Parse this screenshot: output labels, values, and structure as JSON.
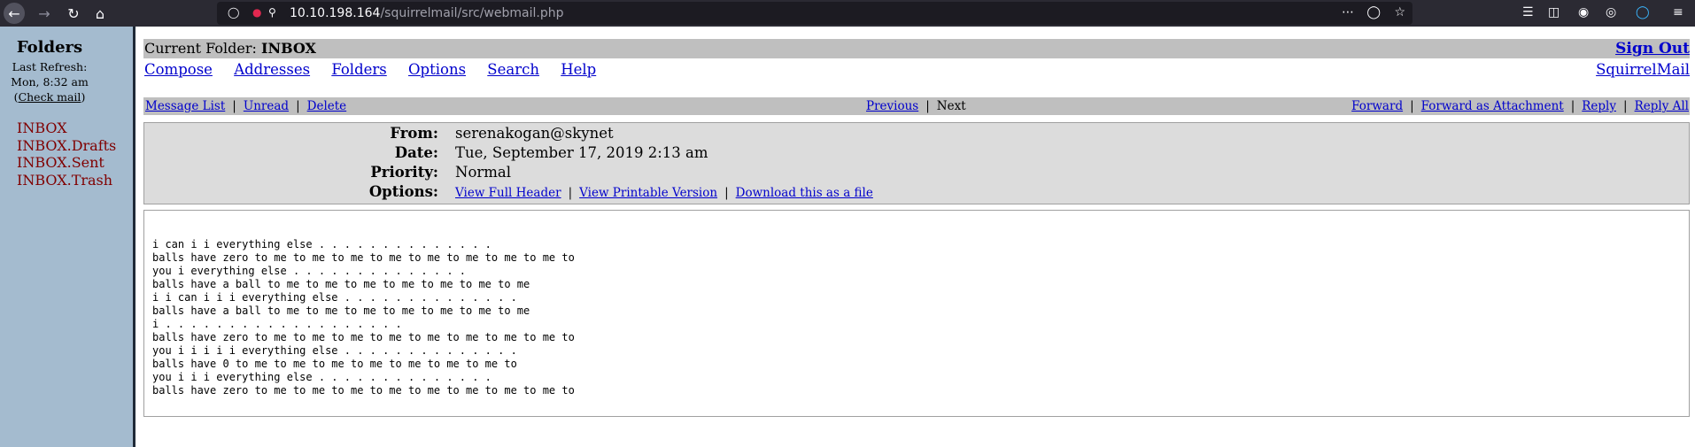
{
  "browser": {
    "url_host": "10.10.198.164",
    "url_path": "/squirrelmail/src/webmail.php"
  },
  "left": {
    "title": "Folders",
    "last_refresh_label": "Last  Refresh:",
    "last_refresh_time": "Mon,  8:32  am",
    "check_mail": "Check mail",
    "folders": [
      "INBOX",
      "INBOX.Drafts",
      "INBOX.Sent",
      "INBOX.Trash"
    ]
  },
  "header": {
    "current_folder_label": "Current Folder: ",
    "current_folder": "INBOX",
    "sign_out": "Sign Out",
    "menu": [
      "Compose",
      "Addresses",
      "Folders",
      "Options",
      "Search",
      "Help"
    ],
    "squirrelmail": "SquirrelMail"
  },
  "nav": {
    "message_list": "Message List",
    "unread": "Unread",
    "delete": "Delete",
    "previous": "Previous",
    "next": "Next",
    "forward": "Forward",
    "forward_attachment": "Forward as Attachment",
    "reply": "Reply",
    "reply_all": "Reply All"
  },
  "message": {
    "from_label": "From:",
    "from": "serenakogan@skynet",
    "date_label": "Date:",
    "date": "Tue, September 17, 2019 2:13 am",
    "priority_label": "Priority:",
    "priority": "Normal",
    "options_label": "Options:",
    "view_full_header": "View Full Header",
    "view_printable": "View Printable Version",
    "download": "Download this as a file",
    "body": "i can i i everything else . . . . . . . . . . . . . .\nballs have zero to me to me to me to me to me to me to me to me to\nyou i everything else . . . . . . . . . . . . . .\nballs have a ball to me to me to me to me to me to me to me\ni i can i i i everything else . . . . . . . . . . . . . .\nballs have a ball to me to me to me to me to me to me to me\ni . . . . . . . . . . . . . . . . . . .\nballs have zero to me to me to me to me to me to me to me to me to\nyou i i i i i everything else . . . . . . . . . . . . . .\nballs have 0 to me to me to me to me to me to me to me to\nyou i i i everything else . . . . . . . . . . . . . .\nballs have zero to me to me to me to me to me to me to me to me to"
  }
}
